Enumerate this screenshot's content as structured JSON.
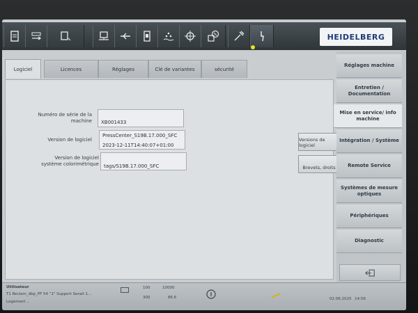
{
  "brand": {
    "logo_text": "HEIDELBERG"
  },
  "toolbar_icons": [
    "document-icon",
    "transfer-icon",
    "layout-icon",
    "press-unit-icon",
    "arrow-icon",
    "feeder-icon",
    "dampening-icon",
    "register-icon",
    "color-icon",
    "tools-icon",
    "power-icon"
  ],
  "tabs": [
    {
      "label": "Logiciel",
      "active": true
    },
    {
      "label": "Licences",
      "active": false
    },
    {
      "label": "Réglages",
      "active": false
    },
    {
      "label": "Clé de variantes",
      "active": false
    },
    {
      "label": "sécurité",
      "active": false
    }
  ],
  "nav": [
    {
      "label": "Réglages machine",
      "active": false
    },
    {
      "label": "Entretien / Documentation",
      "active": false
    },
    {
      "label": "Mise en service/ info machine",
      "active": true
    },
    {
      "label": "Intégration / Système",
      "active": false
    },
    {
      "label": "Remote Service",
      "active": false
    },
    {
      "label": "Systèmes de mesure optiques",
      "active": false
    },
    {
      "label": "Périphériques",
      "active": false
    },
    {
      "label": "Diagnostic",
      "active": false
    }
  ],
  "info": {
    "serial_label": "Numéro de série de la machine",
    "serial_value": "XB001433",
    "software_label": "Version de logiciel",
    "software_line1": "PressCenter_S19B.17.000_SFC",
    "software_line2": "2023-12-11T14:40:07+01:00",
    "color_label": "Version de logiciel système colorimétrique",
    "color_value": "tags/S19B.17.000_SFC"
  },
  "buttons": {
    "versions": "Versions de logiciel",
    "patents": "Brevets, droits"
  },
  "status": {
    "left_title": "Utilisateur",
    "left_line2": "T1 Reclam_dbp_PF 54 \"1\" Support Serait 1...",
    "left_line3": "Logement ..",
    "counter_a": "100",
    "counter_b": "10000",
    "counter_c": "300",
    "counter_d": "86.6",
    "date": "02.06.2025",
    "time": "14:56"
  }
}
